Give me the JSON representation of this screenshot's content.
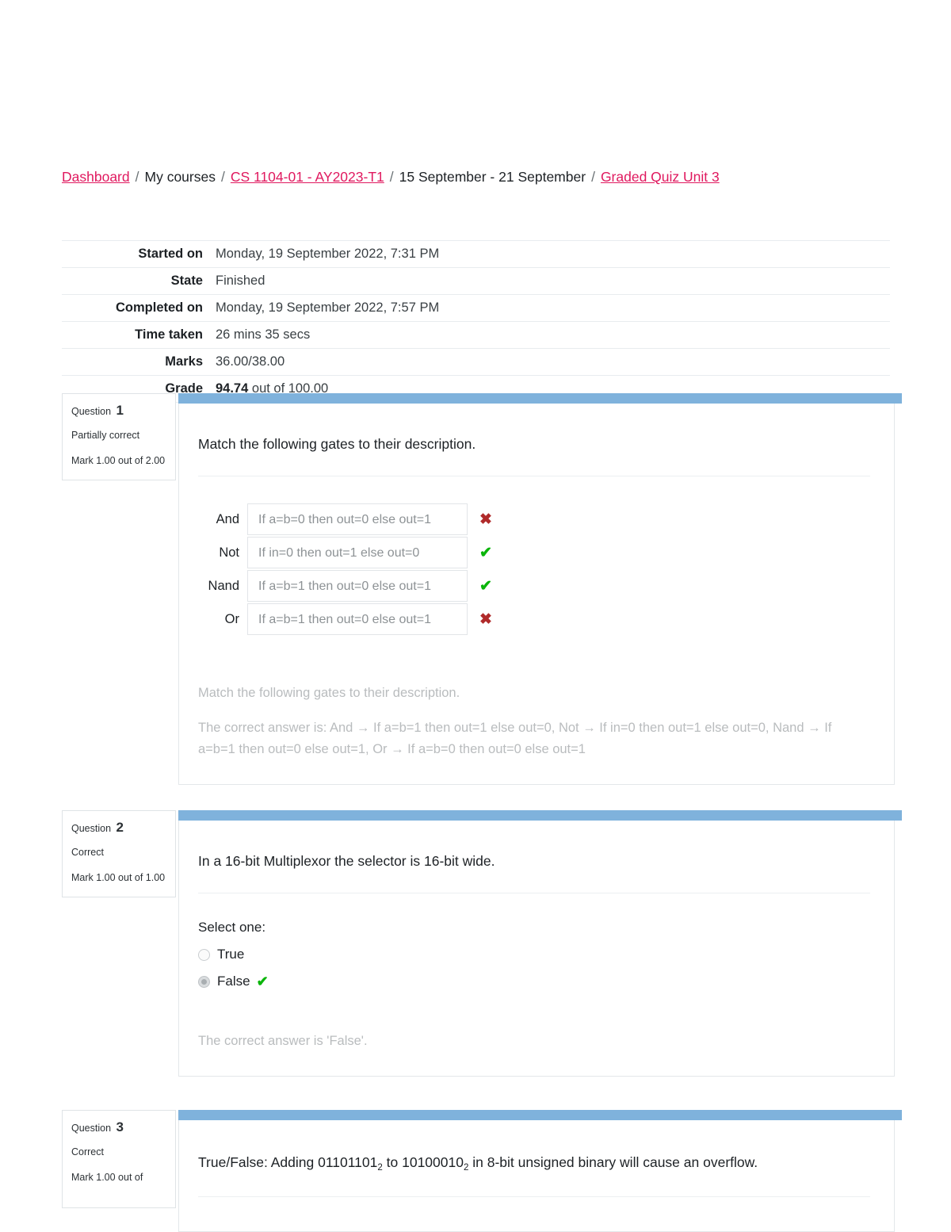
{
  "breadcrumb": {
    "items": [
      {
        "label": "Dashboard",
        "link": true
      },
      {
        "label": "My courses",
        "link": false
      },
      {
        "label": "CS 1104-01 - AY2023-T1",
        "link": true
      },
      {
        "label": "15 September - 21 September",
        "link": false
      },
      {
        "label": "Graded Quiz Unit 3",
        "link": true
      }
    ],
    "separator": "/"
  },
  "summary": {
    "rows": [
      {
        "label": "Started on",
        "value": "Monday, 19 September 2022, 7:31 PM"
      },
      {
        "label": "State",
        "value": "Finished"
      },
      {
        "label": "Completed on",
        "value": "Monday, 19 September 2022, 7:57 PM"
      },
      {
        "label": "Time taken",
        "value": "26 mins 35 secs"
      },
      {
        "label": "Marks",
        "value": "36.00/38.00"
      }
    ],
    "grade": {
      "label": "Grade",
      "value_bold": "94.74",
      "value_rest": "out of 100.00"
    }
  },
  "icons": {
    "correct": "✔",
    "wrong": "✖",
    "arrow": "→"
  },
  "colors": {
    "accent_bar": "#7fb2dc",
    "link": "#e0195f",
    "correct": "#0bb50b",
    "wrong": "#b02a2a",
    "feedback_text": "#b9bcbe"
  },
  "questions": [
    {
      "number_label": "Question",
      "number": "1",
      "state": "Partially correct",
      "mark": "Mark 1.00 out of 2.00",
      "type": "matching",
      "stem": "Match the following gates to their description.",
      "rows": [
        {
          "label": "And",
          "selected": "If a=b=0 then out=0 else out=1",
          "result": "wrong"
        },
        {
          "label": "Not",
          "selected": "If in=0 then out=1 else out=0",
          "result": "correct"
        },
        {
          "label": "Nand",
          "selected": "If a=b=1 then out=0 else out=1",
          "result": "correct"
        },
        {
          "label": "Or",
          "selected": "If a=b=1 then out=0 else out=1",
          "result": "wrong"
        }
      ],
      "feedback_title": "Match the following gates to their description.",
      "feedback_answer": "The correct answer is: And → If a=b=1 then out=1 else out=0, Not → If in=0 then out=1 else out=0, Nand → If a=b=1 then out=0 else out=1, Or → If a=b=0 then out=0 else out=1"
    },
    {
      "number_label": "Question",
      "number": "2",
      "state": "Correct",
      "mark": "Mark 1.00 out of 1.00",
      "type": "truefalse",
      "stem": "In a 16-bit Multiplexor the selector is 16-bit wide.",
      "select_prompt": "Select one:",
      "options": [
        {
          "label": "True",
          "checked": false,
          "result": ""
        },
        {
          "label": "False",
          "checked": true,
          "result": "correct"
        }
      ],
      "feedback_answer": "The correct answer is 'False'."
    },
    {
      "number_label": "Question",
      "number": "3",
      "state": "Correct",
      "mark": "Mark 1.00 out of",
      "type": "truefalse",
      "stem_parts": [
        {
          "text": "True/False: Adding 01101101",
          "sub": false
        },
        {
          "text": "2",
          "sub": true
        },
        {
          "text": " to 10100010",
          "sub": false
        },
        {
          "text": "2",
          "sub": true
        },
        {
          "text": " in 8-bit unsigned binary will cause an overflow.",
          "sub": false
        }
      ]
    }
  ]
}
